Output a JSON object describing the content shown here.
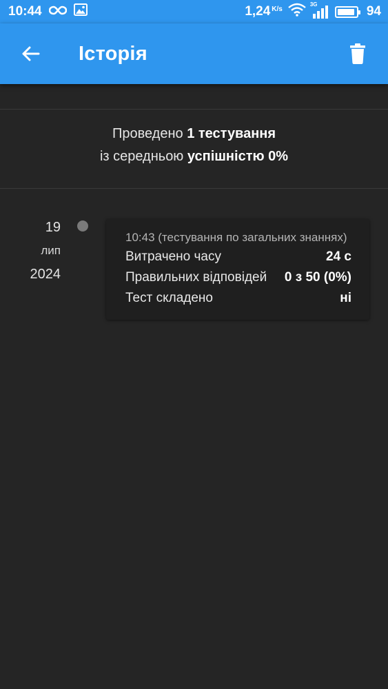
{
  "status_bar": {
    "time": "10:44",
    "infinity_icon": "infinity-icon",
    "image_icon": "image-icon",
    "net_speed": "1,24",
    "net_speed_unit": "K/s",
    "network_type": "3G",
    "battery_level": "94",
    "battery_fraction": 0.94
  },
  "app_bar": {
    "title": "Історія",
    "back_icon": "arrow-left-icon",
    "delete_icon": "trash-icon",
    "background": "#2f96ee"
  },
  "summary": {
    "line1_prefix": "Проведено ",
    "line1_bold": "1 тестування",
    "line2_prefix": "із середньою ",
    "line2_bold": "успішністю 0%"
  },
  "history": [
    {
      "date_day": "19",
      "date_month": "лип",
      "date_year": "2024",
      "title": "10:43 (тестування по загальних знаннях)",
      "rows": [
        {
          "label": "Витрачено часу",
          "value": "24 с"
        },
        {
          "label": "Правильних відповідей",
          "value": "0 з 50 (0%)"
        },
        {
          "label": "Тест складено",
          "value": "ні"
        }
      ]
    }
  ]
}
